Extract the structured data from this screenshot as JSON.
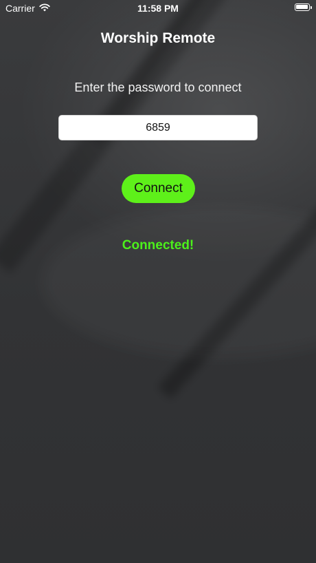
{
  "status_bar": {
    "carrier": "Carrier",
    "time": "11:58 PM",
    "icons": [
      "wifi-icon",
      "battery-icon"
    ]
  },
  "app": {
    "title": "Worship Remote",
    "prompt": "Enter the password to connect",
    "password_value": "6859",
    "connect_label": "Connect",
    "status_text": "Connected!"
  },
  "colors": {
    "background": "#303133",
    "accent_button": "#5ef01a",
    "status_success": "#4cf01b",
    "text": "#ffffff"
  }
}
